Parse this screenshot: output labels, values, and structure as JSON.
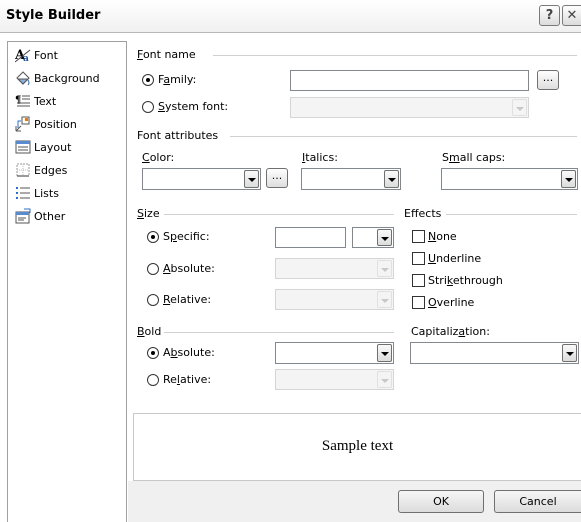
{
  "window": {
    "title": "Style Builder",
    "help_glyph": "?",
    "close_glyph": "✕"
  },
  "sidebar": {
    "items": [
      {
        "label": "Font",
        "icon": "font-icon"
      },
      {
        "label": "Background",
        "icon": "background-icon"
      },
      {
        "label": "Text",
        "icon": "text-icon"
      },
      {
        "label": "Position",
        "icon": "position-icon"
      },
      {
        "label": "Layout",
        "icon": "layout-icon"
      },
      {
        "label": "Edges",
        "icon": "edges-icon"
      },
      {
        "label": "Lists",
        "icon": "lists-icon"
      },
      {
        "label": "Other",
        "icon": "other-icon"
      }
    ],
    "selected": "Font"
  },
  "font_name": {
    "header": "Font name",
    "family_label": "Family:",
    "family_value": "",
    "system_font_label": "System font:",
    "system_font_value": "",
    "selected": "Family",
    "browse": "..."
  },
  "font_attributes": {
    "header": "Font attributes",
    "color_label": "Color:",
    "color_value": "",
    "italics_label": "Italics:",
    "italics_value": "",
    "small_caps_label": "Small caps:",
    "small_caps_value": "",
    "browse": "..."
  },
  "size": {
    "header": "Size",
    "specific_label": "Specific:",
    "specific_value": "",
    "absolute_label": "Absolute:",
    "relative_label": "Relative:",
    "selected": "Specific"
  },
  "effects": {
    "header": "Effects",
    "none": "None",
    "underline": "Underline",
    "strikethrough": "Strikethrough",
    "overline": "Overline",
    "checked": []
  },
  "bold": {
    "header": "Bold",
    "absolute_label": "Absolute:",
    "relative_label": "Relative:",
    "selected": "Absolute"
  },
  "capitalization": {
    "header": "Capitalization:",
    "value": ""
  },
  "preview": {
    "text": "Sample text"
  },
  "footer": {
    "ok": "OK",
    "cancel": "Cancel"
  }
}
